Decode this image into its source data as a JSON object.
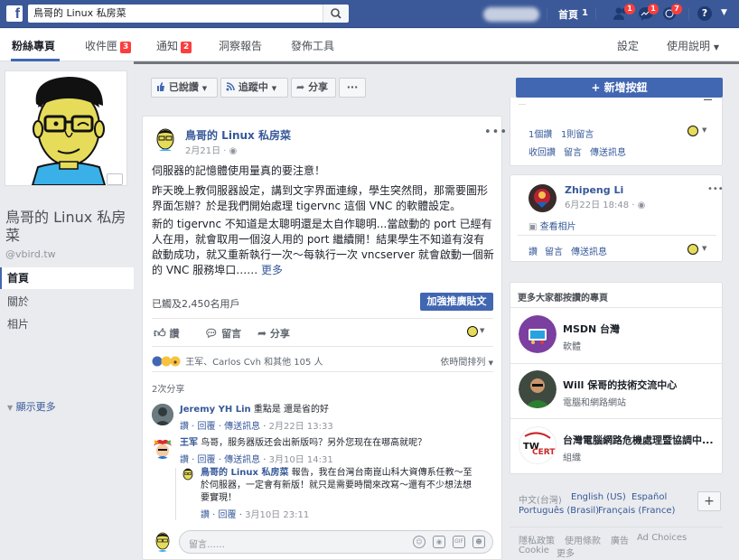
{
  "topbar": {
    "logo": "f",
    "search_value": "鳥哥的 Linux 私房菜",
    "home_label": "首頁",
    "home_count": "1",
    "friend_requests_badge": "1",
    "messages_badge": "1",
    "notifications_badge": "7",
    "help_label": "?"
  },
  "page_nav": {
    "tabs": [
      {
        "label": "粉絲專頁"
      },
      {
        "label": "收件匣",
        "badge": "3"
      },
      {
        "label": "通知",
        "badge": "2"
      },
      {
        "label": "洞察報告"
      },
      {
        "label": "發佈工具"
      }
    ],
    "settings_label": "設定",
    "help_label": "使用說明"
  },
  "left": {
    "page_name": "鳥哥的 Linux 私房菜",
    "handle": "@vbird.tw",
    "nav": [
      "首頁",
      "關於",
      "相片"
    ],
    "more": "顯示更多"
  },
  "action_bar": {
    "liked": "已說讚",
    "following": "追蹤中",
    "share": "分享",
    "more": "···",
    "cta": "+ 新增按鈕"
  },
  "post": {
    "author": "鳥哥的 Linux 私房菜",
    "date": "2月21日 · ",
    "para1": "伺服器的記憶體使用量真的要注意！",
    "para2": "昨天晚上教伺服器設定，講到文字界面連線，學生突然問，那需要圖形界面怎辦？於是我們開始處理 tigervnc 這個 VNC 的軟體設定。",
    "para3": "新的 tigervnc 不知道是太聰明還是太自作聰明...當啟動的 port 已經有人在用，就會取用一個沒人用的 port 繼續開！結果學生不知道有沒有啟動成功，就又重新執行一次～每執行一次 vncserver 就會啟動一個新的 VNC 服務埠口……",
    "see_more": "更多",
    "reach": "已觸及2,450名用戶",
    "boost": "加強推廣貼文",
    "like": "讚",
    "comment": "留言",
    "share": "分享",
    "reactions": "王军、Carlos Cvh 和其他 105 人",
    "sort": "依時間排列",
    "shares": "2次分享",
    "comments": [
      {
        "name": "Jeremy YH Lin",
        "text": "重點是 還是省的好",
        "like": "讚",
        "reply": "回覆",
        "msg": "傳送訊息",
        "time": "2月22日 13:33"
      },
      {
        "name": "王军",
        "text": "鸟哥，服务器版还会出新版吗？另外您现在在哪高就呢？",
        "like": "讚",
        "reply": "回覆",
        "msg": "傳送訊息",
        "time": "3月10日 14:31"
      },
      {
        "name": "鳥哥的 Linux 私房菜",
        "text": "報告，我在台灣台南崑山科大資傳系任教～至於伺服器，一定會有新版！就只是需要時間來改寫～還有不少想法想要實現！",
        "like": "讚",
        "reply": "回覆",
        "time": "3月10日 23:11"
      }
    ],
    "comment_placeholder": "留言……"
  },
  "right": {
    "card1": {
      "likes": "1個讚",
      "comments": "1則留言",
      "recall": "收回讚",
      "comment": "留言",
      "msg": "傳送訊息"
    },
    "card2": {
      "name": "Zhipeng Li",
      "time": "6月22日 18:48 · ",
      "view_photo": "查看相片",
      "like": "讚",
      "comment": "留言",
      "msg": "傳送訊息"
    },
    "suggest_title": "更多大家都按讚的專頁",
    "suggestions": [
      {
        "name": "MSDN 台灣",
        "category": "軟體"
      },
      {
        "name": "Will 保哥的技術交流中心",
        "category": "電腦和網路網站"
      },
      {
        "name": "台灣電腦網路危機處理暨協調中...",
        "category": "組織"
      }
    ],
    "languages": [
      "中文(台灣)",
      "English (US)",
      "Español",
      "Português (Brasil)",
      "Français (France)"
    ],
    "footer": [
      "隱私政策",
      "使用條款",
      "廣告",
      "Ad Choices",
      "Cookie",
      "更多"
    ]
  },
  "colors": {
    "brand": "#3b5998",
    "accent": "#4267b2",
    "badge": "#fa3e3e"
  }
}
